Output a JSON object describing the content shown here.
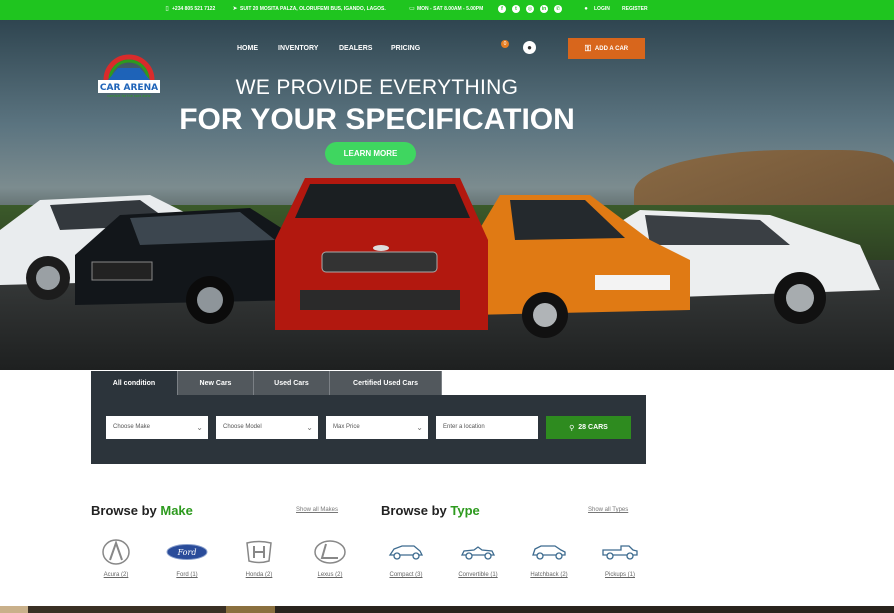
{
  "topbar": {
    "phone": "+234 805 521 7122",
    "address": "SUIT 20 MOSITA PALZA, OLORUFEMI BUS, IGANDO, LAGOS.",
    "hours": "MON - SAT 8.00AM - 5.00PM",
    "login": "LOGIN",
    "register": "REGISTER",
    "social_icons": [
      "facebook-icon",
      "twitter-icon",
      "instagram-icon",
      "linkedin-icon",
      "whatsapp-icon"
    ]
  },
  "logo": {
    "name": "CAR ARENA",
    "tagline": "comfort for the rods done"
  },
  "nav": {
    "home": "HOME",
    "inventory": "INVENTORY",
    "dealers": "DEALERS",
    "pricing": "PRICING"
  },
  "cart": {
    "count": "0"
  },
  "add_car": {
    "label": "ADD A CAR"
  },
  "hero": {
    "line1": "WE PROVIDE EVERYTHING",
    "line2": "FOR YOUR SPECIFICATION",
    "cta": "LEARN MORE"
  },
  "search": {
    "tabs": [
      "All condition",
      "New Cars",
      "Used Cars",
      "Certified Used Cars"
    ],
    "make_placeholder": "Choose Make",
    "model_placeholder": "Choose Model",
    "price_placeholder": "Max Price",
    "location_placeholder": "Enter a location",
    "button": "28 CARS"
  },
  "browse_make": {
    "title_prefix": "Browse by",
    "title_accent": "Make",
    "show_all": "Show all Makes",
    "items": [
      {
        "label": "Acura (2)",
        "icon": "acura-logo-icon"
      },
      {
        "label": "Ford (1)",
        "icon": "ford-logo-icon"
      },
      {
        "label": "Honda (2)",
        "icon": "honda-logo-icon"
      },
      {
        "label": "Lexus (2)",
        "icon": "lexus-logo-icon"
      }
    ]
  },
  "browse_type": {
    "title_prefix": "Browse by",
    "title_accent": "Type",
    "show_all": "Show all Types",
    "items": [
      {
        "label": "Compact (3)",
        "icon": "compact-car-icon"
      },
      {
        "label": "Convertible (1)",
        "icon": "convertible-car-icon"
      },
      {
        "label": "Hatchback (2)",
        "icon": "hatchback-car-icon"
      },
      {
        "label": "Pickups (1)",
        "icon": "pickup-truck-icon"
      }
    ]
  },
  "colors": {
    "green": "#1fc51f",
    "accent_green": "#2d9a1e",
    "orange": "#d8661c",
    "panel": "#2c343b"
  }
}
